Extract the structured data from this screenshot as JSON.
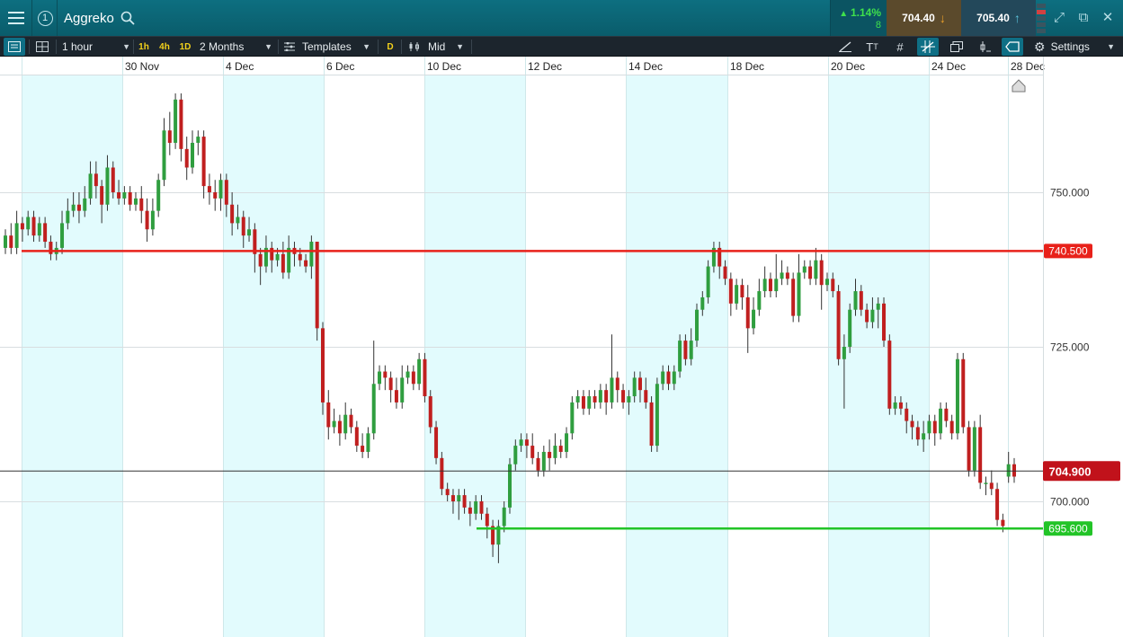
{
  "header": {
    "market_name": "Aggreko",
    "change_percent": "1.14%",
    "change_points": "8",
    "sell_price": "704.40",
    "buy_price": "705.40"
  },
  "toolbar": {
    "interval": "1 hour",
    "quick_intervals": [
      "1h",
      "4h",
      "1D"
    ],
    "range": "2 Months",
    "templates": "Templates",
    "d_button": "D",
    "price_type": "Mid",
    "settings": "Settings"
  },
  "icons": {
    "menu": "hamburger-menu-icon",
    "link": "link-number-icon",
    "search": "search-icon",
    "chart_type": "chart-type-icon",
    "layout": "layout-grid-icon",
    "draw": "drawing-tool-icon",
    "text": "text-size-icon",
    "grid": "grid-icon",
    "crosshair": "crosshair-icon",
    "copy": "copy-icon",
    "indicator": "indicator-icon",
    "label": "price-label-icon",
    "settings": "gear-icon",
    "expand": "expand-icon",
    "popout": "pop-out-icon",
    "close": "close-icon",
    "scroll_end": "scroll-to-end-icon"
  },
  "colors": {
    "titlebar": "#0a6473",
    "toolbar": "#1c252d",
    "bull": "#2f9e3f",
    "bear": "#c01f1f",
    "resistance": "#e8211a",
    "support": "#22c427",
    "shade": "#e2fbfd",
    "current_tag": "#c1121b"
  },
  "chart_data": {
    "type": "candlestick",
    "title": "",
    "x_labels": [
      "30 Nov",
      "4 Dec",
      "6 Dec",
      "10 Dec",
      "12 Dec",
      "14 Dec",
      "18 Dec",
      "20 Dec",
      "24 Dec",
      "28 Dec"
    ],
    "y_ticks": [
      "750.000",
      "725.000",
      "700.000"
    ],
    "y_range": [
      683,
      768
    ],
    "horizontal_lines": [
      {
        "value": 740.5,
        "label": "740.500",
        "color": "#e8211a"
      },
      {
        "value": 695.6,
        "label": "695.600",
        "color": "#22c427"
      }
    ],
    "current_price": {
      "value": 704.9,
      "label": "704.900"
    },
    "grid": true,
    "candles": [
      [
        741,
        743,
        744,
        740
      ],
      [
        743,
        741,
        745,
        740
      ],
      [
        741,
        745,
        747,
        740
      ],
      [
        745,
        744,
        746,
        742
      ],
      [
        744,
        746,
        747,
        743
      ],
      [
        746,
        743,
        747,
        742
      ],
      [
        743,
        745,
        746,
        742
      ],
      [
        745,
        742,
        746,
        741
      ],
      [
        742,
        740,
        743,
        739
      ],
      [
        740,
        741,
        742,
        739
      ],
      [
        741,
        745,
        747,
        740
      ],
      [
        745,
        747,
        749,
        744
      ],
      [
        747,
        748,
        750,
        746
      ],
      [
        748,
        747,
        750,
        745
      ],
      [
        747,
        749,
        751,
        746
      ],
      [
        749,
        753,
        755,
        748
      ],
      [
        753,
        751,
        755,
        749
      ],
      [
        751,
        748,
        752,
        745
      ],
      [
        748,
        754,
        756,
        747
      ],
      [
        754,
        750,
        755,
        749
      ],
      [
        750,
        749,
        752,
        748
      ],
      [
        749,
        750,
        751,
        748
      ],
      [
        750,
        748,
        751,
        747
      ],
      [
        748,
        749,
        750,
        747
      ],
      [
        749,
        747,
        751,
        745
      ],
      [
        747,
        744,
        749,
        742
      ],
      [
        744,
        747,
        749,
        743
      ],
      [
        747,
        752,
        753,
        746
      ],
      [
        752,
        760,
        762,
        751
      ],
      [
        760,
        758,
        763,
        756
      ],
      [
        758,
        765,
        766,
        757
      ],
      [
        765,
        757,
        766,
        755
      ],
      [
        757,
        754,
        759,
        752
      ],
      [
        754,
        758,
        760,
        753
      ],
      [
        758,
        759,
        760,
        756
      ],
      [
        759,
        751,
        760,
        749
      ],
      [
        751,
        750,
        753,
        748
      ],
      [
        750,
        749,
        752,
        747
      ],
      [
        749,
        752,
        753,
        747
      ],
      [
        752,
        748,
        753,
        746
      ],
      [
        748,
        745,
        750,
        743
      ],
      [
        745,
        746,
        748,
        744
      ],
      [
        746,
        743,
        747,
        741
      ],
      [
        743,
        744,
        746,
        742
      ],
      [
        744,
        740,
        745,
        737
      ],
      [
        740,
        738,
        741,
        735
      ],
      [
        738,
        741,
        743,
        737
      ],
      [
        741,
        739,
        742,
        737
      ],
      [
        739,
        740,
        741,
        738
      ],
      [
        740,
        737,
        742,
        736
      ],
      [
        737,
        741,
        743,
        736
      ],
      [
        741,
        740,
        742,
        738
      ],
      [
        740,
        739,
        741,
        738
      ],
      [
        739,
        738,
        740,
        737
      ],
      [
        738,
        742,
        743,
        736
      ],
      [
        742,
        728,
        742,
        726
      ],
      [
        728,
        716,
        729,
        714
      ],
      [
        716,
        712,
        718,
        710
      ],
      [
        712,
        713,
        715,
        711
      ],
      [
        713,
        711,
        714,
        709
      ],
      [
        711,
        714,
        716,
        710
      ],
      [
        714,
        712,
        715,
        711
      ],
      [
        712,
        709,
        713,
        708
      ],
      [
        709,
        708,
        711,
        707
      ],
      [
        708,
        711,
        712,
        707
      ],
      [
        711,
        719,
        726,
        710
      ],
      [
        719,
        721,
        722,
        718
      ],
      [
        721,
        720,
        722,
        718
      ],
      [
        720,
        718,
        721,
        716
      ],
      [
        718,
        716,
        720,
        715
      ],
      [
        716,
        720,
        722,
        715
      ],
      [
        720,
        721,
        722,
        719
      ],
      [
        721,
        719,
        722,
        718
      ],
      [
        719,
        723,
        724,
        718
      ],
      [
        723,
        717,
        724,
        716
      ],
      [
        717,
        712,
        718,
        711
      ],
      [
        712,
        707,
        713,
        706
      ],
      [
        707,
        702,
        708,
        701
      ],
      [
        702,
        701,
        703,
        700
      ],
      [
        701,
        700,
        702,
        698
      ],
      [
        700,
        701,
        702,
        697
      ],
      [
        701,
        699,
        702,
        698
      ],
      [
        699,
        698,
        700,
        696
      ],
      [
        698,
        700,
        701,
        697
      ],
      [
        700,
        698,
        701,
        697
      ],
      [
        698,
        696,
        699,
        694
      ],
      [
        696,
        693,
        697,
        691
      ],
      [
        693,
        696,
        697,
        690
      ],
      [
        696,
        699,
        700,
        695
      ],
      [
        699,
        706,
        707,
        698
      ],
      [
        706,
        709,
        710,
        705
      ],
      [
        709,
        710,
        711,
        708
      ],
      [
        710,
        709,
        711,
        707
      ],
      [
        709,
        707,
        711,
        706
      ],
      [
        707,
        705,
        708,
        704
      ],
      [
        705,
        708,
        709,
        704
      ],
      [
        708,
        707,
        710,
        705
      ],
      [
        707,
        709,
        711,
        706
      ],
      [
        709,
        708,
        710,
        707
      ],
      [
        708,
        711,
        712,
        707
      ],
      [
        711,
        716,
        717,
        710
      ],
      [
        716,
        717,
        718,
        715
      ],
      [
        717,
        715,
        718,
        714
      ],
      [
        715,
        717,
        718,
        714
      ],
      [
        717,
        716,
        718,
        715
      ],
      [
        716,
        718,
        719,
        715
      ],
      [
        718,
        716,
        719,
        714
      ],
      [
        716,
        720,
        727,
        715
      ],
      [
        720,
        718,
        721,
        716
      ],
      [
        718,
        716,
        719,
        715
      ],
      [
        716,
        717,
        718,
        714
      ],
      [
        717,
        720,
        721,
        716
      ],
      [
        720,
        718,
        721,
        716
      ],
      [
        718,
        716,
        720,
        715
      ],
      [
        716,
        709,
        717,
        708
      ],
      [
        709,
        719,
        720,
        708
      ],
      [
        719,
        721,
        722,
        718
      ],
      [
        721,
        719,
        722,
        718
      ],
      [
        719,
        721,
        722,
        718
      ],
      [
        721,
        726,
        727,
        720
      ],
      [
        726,
        723,
        727,
        722
      ],
      [
        723,
        726,
        728,
        722
      ],
      [
        726,
        731,
        732,
        725
      ],
      [
        731,
        733,
        734,
        730
      ],
      [
        733,
        738,
        739,
        732
      ],
      [
        738,
        741,
        742,
        737
      ],
      [
        741,
        738,
        742,
        736
      ],
      [
        738,
        736,
        739,
        735
      ],
      [
        736,
        732,
        737,
        730
      ],
      [
        732,
        735,
        736,
        731
      ],
      [
        735,
        733,
        736,
        731
      ],
      [
        733,
        728,
        735,
        724
      ],
      [
        728,
        731,
        733,
        727
      ],
      [
        731,
        734,
        736,
        730
      ],
      [
        734,
        736,
        738,
        733
      ],
      [
        736,
        734,
        737,
        733
      ],
      [
        734,
        736,
        740,
        733
      ],
      [
        736,
        737,
        739,
        735
      ],
      [
        737,
        736,
        738,
        735
      ],
      [
        736,
        730,
        737,
        729
      ],
      [
        730,
        737,
        740,
        729
      ],
      [
        737,
        738,
        739,
        736
      ],
      [
        738,
        736,
        739,
        735
      ],
      [
        736,
        739,
        741,
        735
      ],
      [
        739,
        735,
        740,
        731
      ],
      [
        735,
        736,
        737,
        734
      ],
      [
        736,
        734,
        737,
        733
      ],
      [
        734,
        723,
        735,
        722
      ],
      [
        723,
        725,
        727,
        715
      ],
      [
        725,
        731,
        732,
        724
      ],
      [
        731,
        734,
        736,
        730
      ],
      [
        734,
        731,
        735,
        730
      ],
      [
        731,
        729,
        732,
        728
      ],
      [
        729,
        731,
        733,
        728
      ],
      [
        731,
        732,
        733,
        728
      ],
      [
        732,
        726,
        733,
        725
      ],
      [
        726,
        715,
        727,
        714
      ],
      [
        715,
        716,
        717,
        714
      ],
      [
        716,
        715,
        717,
        714
      ],
      [
        715,
        713,
        716,
        711
      ],
      [
        713,
        712,
        714,
        710
      ],
      [
        712,
        710,
        713,
        709
      ],
      [
        710,
        711,
        713,
        708
      ],
      [
        711,
        713,
        714,
        710
      ],
      [
        713,
        711,
        714,
        709
      ],
      [
        711,
        715,
        716,
        710
      ],
      [
        715,
        713,
        716,
        712
      ],
      [
        713,
        711,
        714,
        710
      ],
      [
        711,
        723,
        724,
        710
      ],
      [
        723,
        712,
        724,
        711
      ],
      [
        712,
        705,
        713,
        704
      ],
      [
        705,
        712,
        713,
        704
      ],
      [
        712,
        703,
        714,
        702
      ],
      [
        703,
        703,
        704,
        701
      ],
      [
        703,
        702,
        705,
        701
      ],
      [
        702,
        697,
        703,
        696
      ],
      [
        697,
        696,
        698,
        695
      ],
      [
        704,
        706,
        708,
        703
      ],
      [
        706,
        704,
        707,
        703
      ]
    ]
  }
}
